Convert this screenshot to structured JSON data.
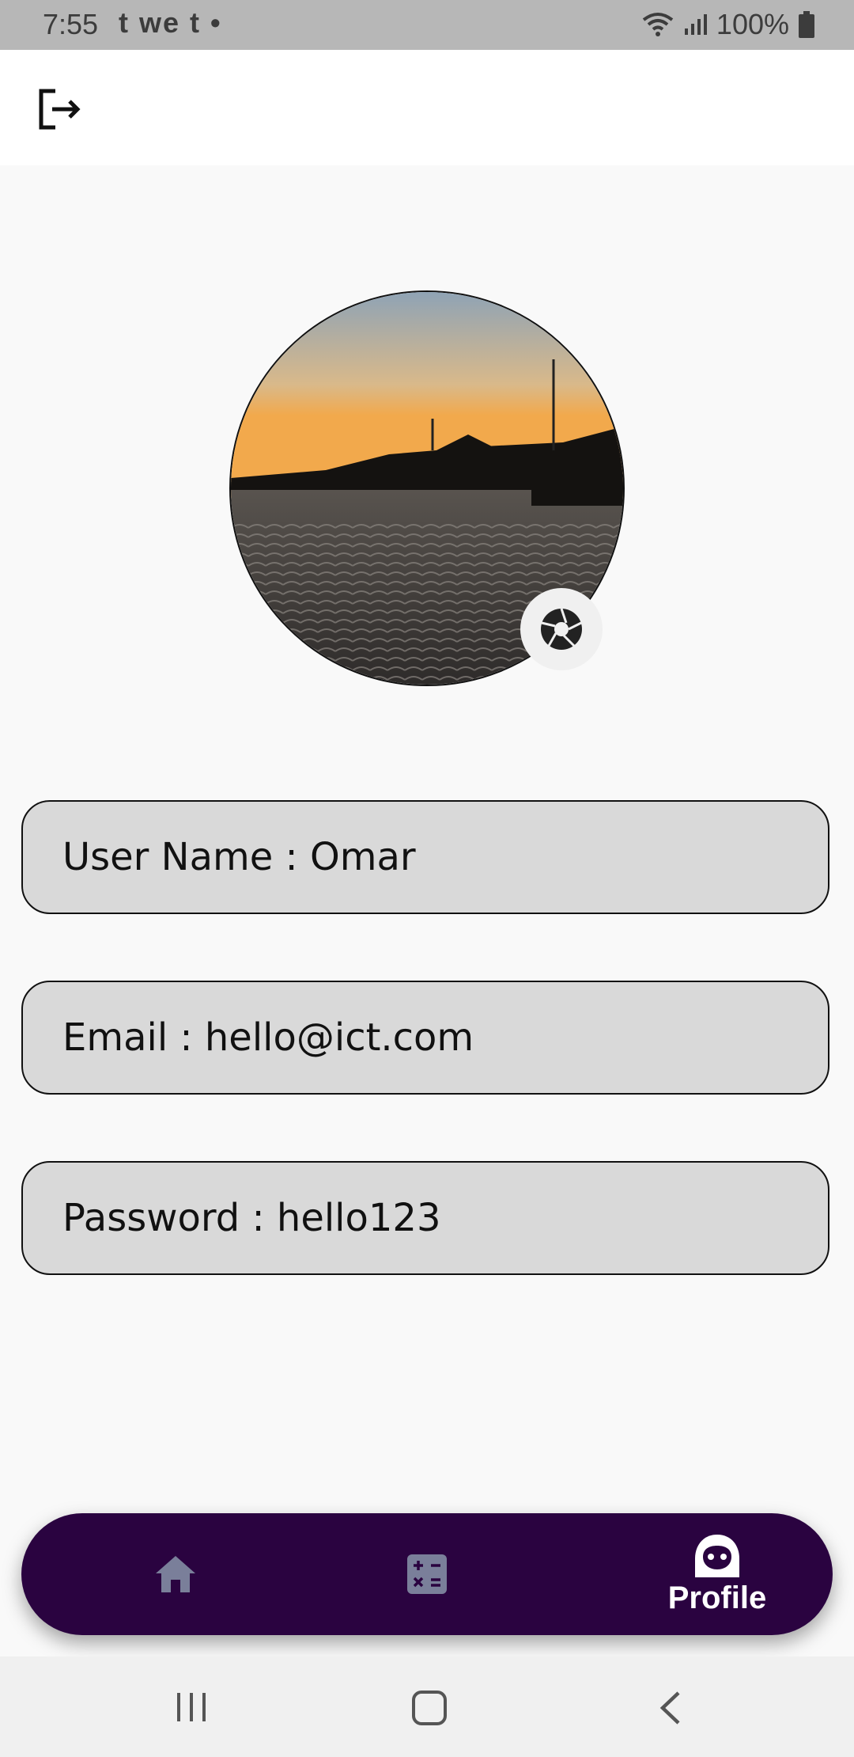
{
  "status_bar": {
    "time": "7:55",
    "left_icons": "t we t •",
    "battery": "100%"
  },
  "profile": {
    "fields": [
      {
        "label": "User Name : Omar"
      },
      {
        "label": "Email : hello@ict.com"
      },
      {
        "label": "Password : hello123"
      }
    ]
  },
  "bottom_nav": {
    "items": [
      {
        "icon": "home-icon",
        "label": ""
      },
      {
        "icon": "calculator-icon",
        "label": ""
      },
      {
        "icon": "profile-icon",
        "label": "Profile",
        "active": true
      }
    ],
    "background": "#2a0340",
    "inactive_icon_color": "#7a7f9a"
  },
  "colors": {
    "field_bg": "#d9d9d9",
    "page_bg": "#f9f9f9"
  }
}
